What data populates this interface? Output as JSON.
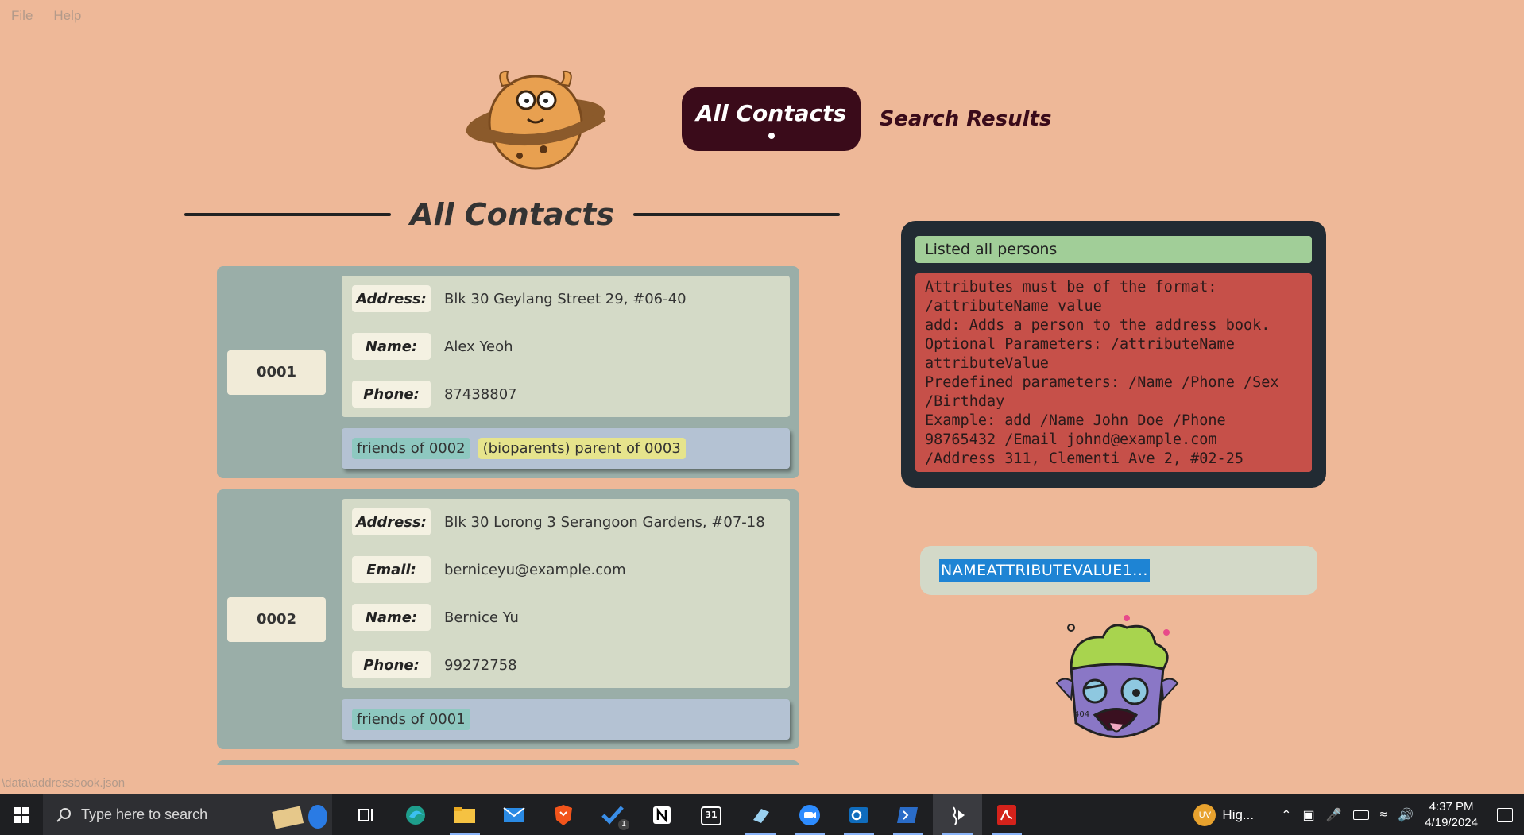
{
  "menu": {
    "file": "File",
    "help": "Help"
  },
  "nav": {
    "all_contacts": "All Contacts",
    "search_results": "Search Results"
  },
  "section_title": "All Contacts",
  "contacts": [
    {
      "id": "0001",
      "fields": [
        {
          "label": "Address:",
          "value": "Blk 30 Geylang Street 29, #06-40"
        },
        {
          "label": "Name:",
          "value": "Alex Yeoh"
        },
        {
          "label": "Phone:",
          "value": "87438807"
        }
      ],
      "tags": [
        {
          "text": "friends of 0002",
          "kind": "friend"
        },
        {
          "text": "(bioparents) parent of 0003",
          "kind": "parent"
        }
      ]
    },
    {
      "id": "0002",
      "fields": [
        {
          "label": "Address:",
          "value": "Blk 30 Lorong 3 Serangoon Gardens, #07-18"
        },
        {
          "label": "Email:",
          "value": "berniceyu@example.com"
        },
        {
          "label": "Name:",
          "value": "Bernice Yu"
        },
        {
          "label": "Phone:",
          "value": "99272758"
        }
      ],
      "tags": [
        {
          "text": "friends of 0001",
          "kind": "friend"
        }
      ]
    }
  ],
  "result": {
    "status": "Listed all persons",
    "message_lines": [
      "Attributes must be of the format:",
      "/attributeName value",
      "add: Adds a person to the address book.",
      "Optional Parameters: /attributeName",
      "attributeValue",
      "Predefined parameters: /Name /Phone /Sex",
      "/Birthday",
      "Example: add /Name John Doe /Phone",
      "98765432 /Email johnd@example.com",
      "/Address 311, Clementi Ave 2, #02-25"
    ]
  },
  "command": {
    "value": "NAMEATTRIBUTEVALUE1..."
  },
  "status_path": "\\data\\addressbook.json",
  "taskbar": {
    "search_placeholder": "Type here to search",
    "weather": "Hig...",
    "weather_badge": "UV",
    "time": "4:37 PM",
    "date": "4/19/2024",
    "todo_badge": "1",
    "calendar_day": "31"
  },
  "colors": {
    "background": "#EEB898",
    "accent": "#3A0B1A",
    "card": "#9AAEA8",
    "status_ok": "#A1CE98",
    "status_err": "#C65049"
  }
}
